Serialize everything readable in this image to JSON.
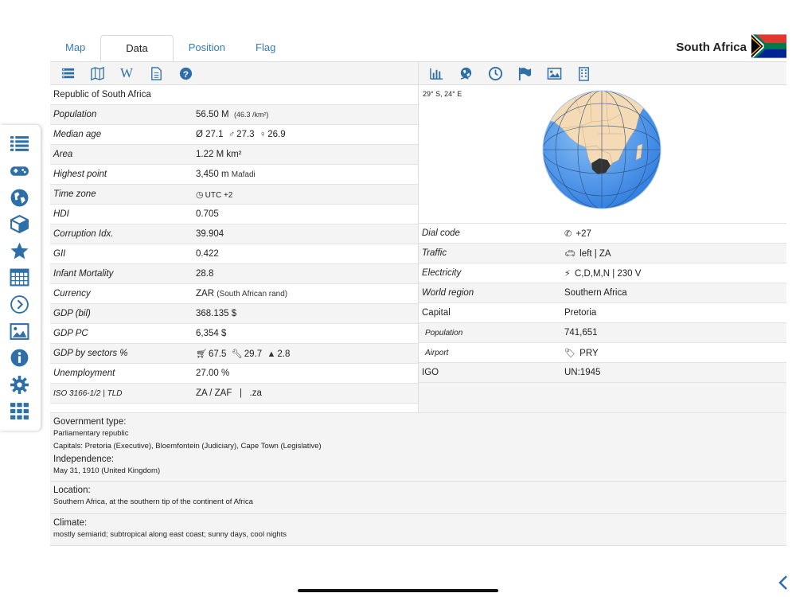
{
  "tabs": [
    "Map",
    "Data",
    "Position",
    "Flag"
  ],
  "country": "South Africa",
  "accent": "#2f6fa8",
  "left_toolbar_icons": [
    "list-view-icon",
    "map-icon",
    "wikipedia-icon",
    "document-icon",
    "help-icon"
  ],
  "right_toolbar_icons": [
    "bar-chart-icon",
    "globe-hand-icon",
    "clock-icon",
    "flag-icon",
    "image-icon",
    "building-icon"
  ],
  "header_name": "Republic of South Africa",
  "left_rows": [
    {
      "label": "Population",
      "value": "56.50 M",
      "extra": "(46.3 /km²)"
    },
    {
      "label": "Median age",
      "value": "Ø 27.1",
      "male": "27.3",
      "female": "26.9"
    },
    {
      "label": "Area",
      "value": "1.22 M km²"
    },
    {
      "label": "Highest point",
      "value": "3,450 m",
      "extra": "Mafadi"
    },
    {
      "label": "Time zone",
      "value": "UTC +2"
    },
    {
      "label": "HDI",
      "value": "0.705"
    },
    {
      "label": "Corruption Idx.",
      "value": "39.904"
    },
    {
      "label": "GII",
      "value": "0.422"
    },
    {
      "label": "Infant Mortality",
      "value": "28.8"
    },
    {
      "label": "Currency",
      "value": "ZAR",
      "extra": "(South African rand)"
    },
    {
      "label": "GDP (bil)",
      "value": "368.135 $"
    },
    {
      "label": "GDP PC",
      "value": "6,354 $"
    },
    {
      "label": "GDP by sectors %",
      "s1": "67.5",
      "s2": "29.7",
      "s3": "2.8"
    },
    {
      "label": "Unemployment",
      "value": "27.00 %"
    },
    {
      "label": "ISO 3166-1/2 | TLD",
      "value": "ZA / ZAF   |   .za"
    }
  ],
  "coords": "29° S, 24° E",
  "right_rows": [
    {
      "label": "Dial code",
      "value": "+27"
    },
    {
      "label": "Traffic",
      "value": "left | ZA"
    },
    {
      "label": "Electricity",
      "value": "C,D,M,N | 230 V"
    },
    {
      "label": "World region",
      "value": "Southern Africa"
    },
    {
      "label": "Capital",
      "value": "Pretoria"
    },
    {
      "label": "Population",
      "value": "741,651"
    },
    {
      "label": "Airport",
      "value": "PRY"
    },
    {
      "label": "IGO",
      "value": "UN:1945"
    }
  ],
  "gov": {
    "h1": "Government type",
    "t1": "Parliamentary republic",
    "t2": "Capitals: Pretoria (Executive), Bloemfontein (Judiciary), Cape Town (Legislative)",
    "h2": "Independence",
    "t3": "May 31, 1910 (United Kingdom)"
  },
  "location": {
    "h": "Location",
    "t": "Southern Africa, at the southern tip of the continent of Africa"
  },
  "climate": {
    "h": "Climate",
    "t": "mostly semiarid; subtropical along east coast; sunny days, cool nights"
  },
  "sidebar_icons": [
    "list-icon",
    "gamepad-icon",
    "globe-icon",
    "cube-icon",
    "star-icon",
    "calendar-icon",
    "chevron-circle-icon",
    "picture-icon",
    "info-icon",
    "settings-icon",
    "grid-icon"
  ]
}
